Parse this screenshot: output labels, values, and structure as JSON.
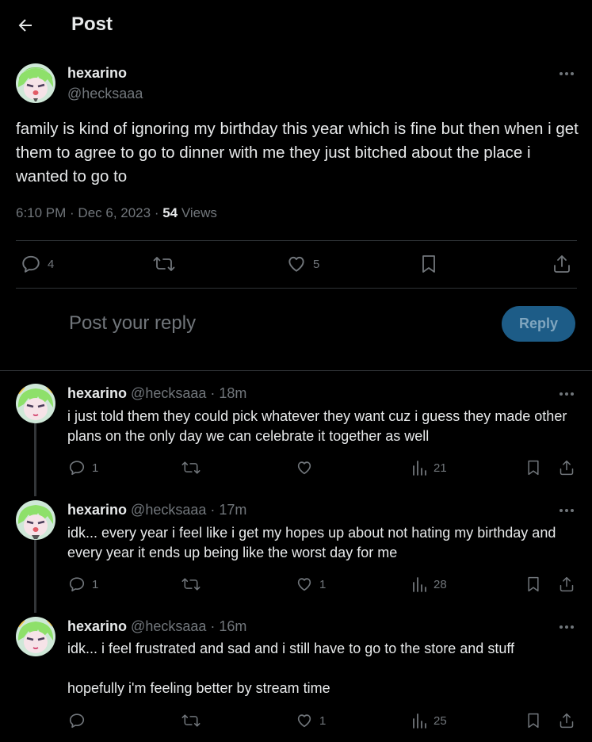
{
  "header": {
    "title": "Post"
  },
  "main_post": {
    "name": "hexarino",
    "handle": "@hecksaaa",
    "text": "family is kind of ignoring my birthday this year which is fine but then when i get them to agree to go to dinner with me they just bitched about the place i wanted to go to",
    "time": "6:10 PM · Dec 6, 2023 · ",
    "views_count": "54",
    "views_label": " Views",
    "replies": "4",
    "likes": "5"
  },
  "composer": {
    "placeholder": "Post your reply",
    "button": "Reply"
  },
  "replies": [
    {
      "name": "hexarino",
      "handle_time": "@hecksaaa · 18m",
      "text": "i just told them they could pick whatever they want cuz i guess they made other plans on the only day we can celebrate it together as well",
      "replies": "1",
      "likes": "",
      "views": "21"
    },
    {
      "name": "hexarino",
      "handle_time": "@hecksaaa · 17m",
      "text": "idk... every year i feel like i get my hopes up about not hating my birthday and every year it ends up being like the worst day for me",
      "replies": "1",
      "likes": "1",
      "views": "28"
    },
    {
      "name": "hexarino",
      "handle_time": "@hecksaaa · 16m",
      "text_line1": "idk... i feel frustrated and sad and i still have to go to the store and stuff",
      "text_line2": "hopefully i'm feeling better by stream time",
      "replies": "",
      "likes": "1",
      "views": "25"
    }
  ],
  "colors": {
    "background": "#000000",
    "text": "#e7e9ea",
    "secondary": "#71767b",
    "divider": "#2f3336",
    "reply_button": "#1d5c87"
  }
}
